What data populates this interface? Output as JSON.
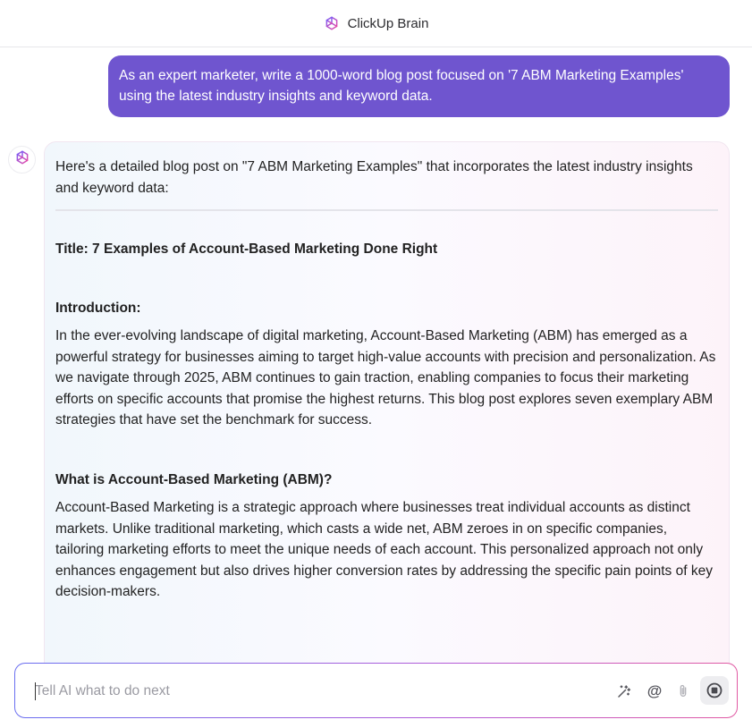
{
  "header": {
    "app_title": "ClickUp Brain",
    "logo_icon": "brain-logo-icon",
    "logo_colors": [
      "#7b5cf5",
      "#e94ba6"
    ]
  },
  "chat": {
    "user_message": "As an expert marketer, write a 1000-word blog post focused on '7 ABM Marketing Examples' using the latest industry insights and keyword data.",
    "assistant": {
      "intro": "Here's a detailed blog post on \"7 ABM Marketing Examples\" that incorporates the latest industry insights and keyword data:",
      "title_line": "Title: 7 Examples of Account-Based Marketing Done Right",
      "introduction_heading": "Introduction:",
      "introduction_body": "In the ever-evolving landscape of digital marketing, Account-Based Marketing (ABM) has emerged as a powerful strategy for businesses aiming to target high-value accounts with precision and personalization. As we navigate through 2025, ABM continues to gain traction, enabling companies to focus their marketing efforts on specific accounts that promise the highest returns. This blog post explores seven exemplary ABM strategies that have set the benchmark for success.",
      "abm_heading": "What is Account-Based Marketing (ABM)?",
      "abm_body": "Account-Based Marketing is a strategic approach where businesses treat individual accounts as distinct markets. Unlike traditional marketing, which casts a wide net, ABM zeroes in on specific companies, tailoring marketing efforts to meet the unique needs of each account. This personalized approach not only enhances engagement but also drives higher conversion rates by addressing the specific pain points of key decision-makers."
    }
  },
  "composer": {
    "placeholder": "Tell AI what to do next",
    "value": "",
    "tools": {
      "wand": "magic-wand-icon",
      "mention": "@",
      "attach": "paperclip-icon",
      "stop": "stop-icon"
    }
  },
  "colors": {
    "user_bubble": "#6f55cf",
    "accent_gradient_start": "#6a6ff0",
    "accent_gradient_end": "#e15aa3"
  }
}
